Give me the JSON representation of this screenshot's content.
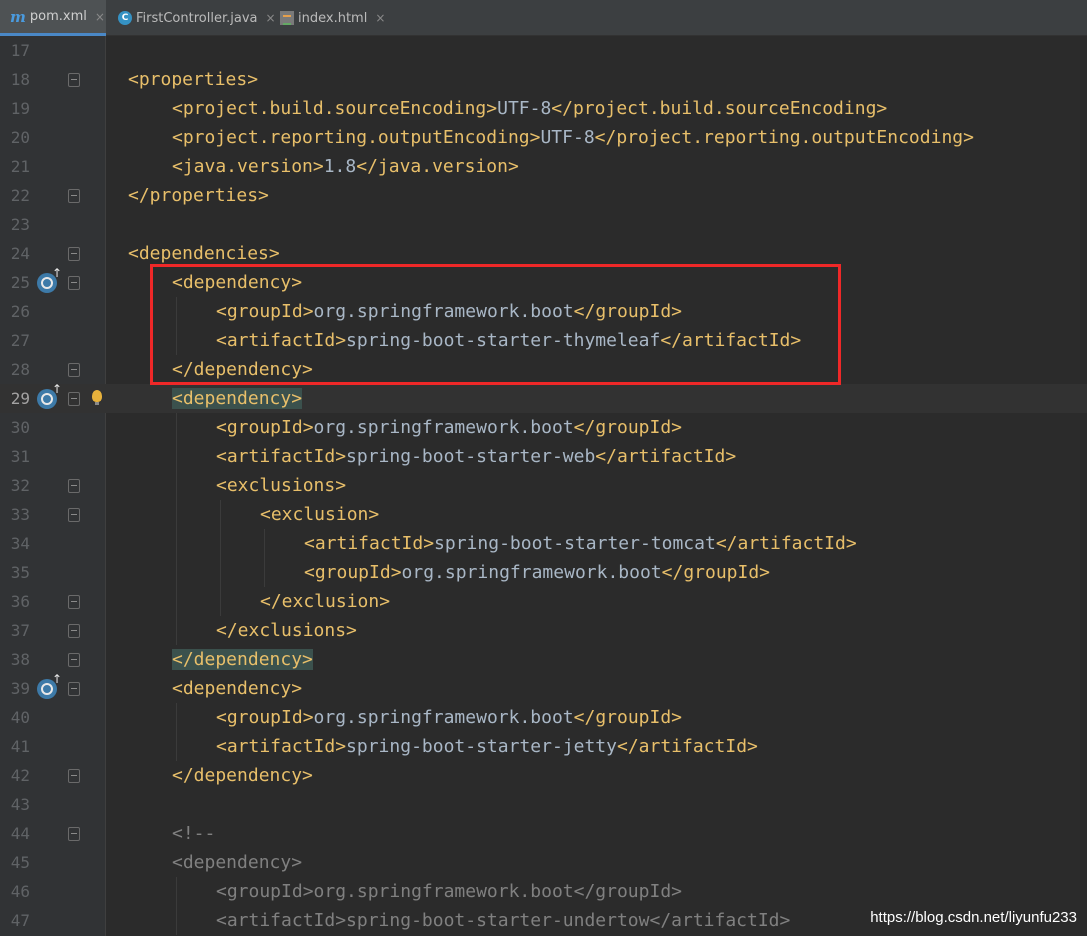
{
  "tabs": [
    {
      "label": "pom.xml",
      "icon": "maven-icon",
      "active": true
    },
    {
      "label": "FirstController.java",
      "icon": "java-class-icon",
      "active": false
    },
    {
      "label": "index.html",
      "icon": "html-file-icon",
      "active": false
    }
  ],
  "tab_close_glyph": "×",
  "lines": [
    {
      "n": "17",
      "indent": 0,
      "code": []
    },
    {
      "n": "18",
      "indent": 0,
      "code": [
        [
          "tag",
          "<properties>"
        ]
      ]
    },
    {
      "n": "19",
      "indent": 1,
      "code": [
        [
          "tag",
          "<project.build.sourceEncoding>"
        ],
        [
          "txt",
          "UTF-8"
        ],
        [
          "tag",
          "</project.build.sourceEncoding>"
        ]
      ]
    },
    {
      "n": "20",
      "indent": 1,
      "code": [
        [
          "tag",
          "<project.reporting.outputEncoding>"
        ],
        [
          "txt",
          "UTF-8"
        ],
        [
          "tag",
          "</project.reporting.outputEncoding>"
        ]
      ]
    },
    {
      "n": "21",
      "indent": 1,
      "code": [
        [
          "tag",
          "<java.version>"
        ],
        [
          "txt",
          "1.8"
        ],
        [
          "tag",
          "</java.version>"
        ]
      ]
    },
    {
      "n": "22",
      "indent": 0,
      "code": [
        [
          "tag",
          "</properties>"
        ]
      ]
    },
    {
      "n": "23",
      "indent": 0,
      "code": []
    },
    {
      "n": "24",
      "indent": 0,
      "code": [
        [
          "tag",
          "<dependencies>"
        ]
      ]
    },
    {
      "n": "25",
      "indent": 1,
      "code": [
        [
          "tag",
          "<dependency>"
        ]
      ]
    },
    {
      "n": "26",
      "indent": 2,
      "code": [
        [
          "tag",
          "<groupId>"
        ],
        [
          "txt",
          "org.springframework.boot"
        ],
        [
          "tag",
          "</groupId>"
        ]
      ]
    },
    {
      "n": "27",
      "indent": 2,
      "code": [
        [
          "tag",
          "<artifactId>"
        ],
        [
          "txt",
          "spring-boot-starter-thymeleaf"
        ],
        [
          "tag",
          "</artifactId>"
        ]
      ]
    },
    {
      "n": "28",
      "indent": 1,
      "code": [
        [
          "tag",
          "</dependency>"
        ]
      ]
    },
    {
      "n": "29",
      "indent": 1,
      "code": [
        [
          "hl",
          "<dependency>"
        ]
      ]
    },
    {
      "n": "30",
      "indent": 2,
      "code": [
        [
          "tag",
          "<groupId>"
        ],
        [
          "txt",
          "org.springframework.boot"
        ],
        [
          "tag",
          "</groupId>"
        ]
      ]
    },
    {
      "n": "31",
      "indent": 2,
      "code": [
        [
          "tag",
          "<artifactId>"
        ],
        [
          "txt",
          "spring-boot-starter-web"
        ],
        [
          "tag",
          "</artifactId>"
        ]
      ]
    },
    {
      "n": "32",
      "indent": 2,
      "code": [
        [
          "tag",
          "<exclusions>"
        ]
      ]
    },
    {
      "n": "33",
      "indent": 3,
      "code": [
        [
          "tag",
          "<exclusion>"
        ]
      ]
    },
    {
      "n": "34",
      "indent": 4,
      "code": [
        [
          "tag",
          "<artifactId>"
        ],
        [
          "txt",
          "spring-boot-starter-tomcat"
        ],
        [
          "tag",
          "</artifactId>"
        ]
      ]
    },
    {
      "n": "35",
      "indent": 4,
      "code": [
        [
          "tag",
          "<groupId>"
        ],
        [
          "txt",
          "org.springframework.boot"
        ],
        [
          "tag",
          "</groupId>"
        ]
      ]
    },
    {
      "n": "36",
      "indent": 3,
      "code": [
        [
          "tag",
          "</exclusion>"
        ]
      ]
    },
    {
      "n": "37",
      "indent": 2,
      "code": [
        [
          "tag",
          "</exclusions>"
        ]
      ]
    },
    {
      "n": "38",
      "indent": 1,
      "code": [
        [
          "hl",
          "</dependency>"
        ]
      ]
    },
    {
      "n": "39",
      "indent": 1,
      "code": [
        [
          "tag",
          "<dependency>"
        ]
      ]
    },
    {
      "n": "40",
      "indent": 2,
      "code": [
        [
          "tag",
          "<groupId>"
        ],
        [
          "txt",
          "org.springframework.boot"
        ],
        [
          "tag",
          "</groupId>"
        ]
      ]
    },
    {
      "n": "41",
      "indent": 2,
      "code": [
        [
          "tag",
          "<artifactId>"
        ],
        [
          "txt",
          "spring-boot-starter-jetty"
        ],
        [
          "tag",
          "</artifactId>"
        ]
      ]
    },
    {
      "n": "42",
      "indent": 1,
      "code": [
        [
          "tag",
          "</dependency>"
        ]
      ]
    },
    {
      "n": "43",
      "indent": 0,
      "code": []
    },
    {
      "n": "44",
      "indent": 1,
      "code": [
        [
          "cmt",
          "<!--"
        ]
      ]
    },
    {
      "n": "45",
      "indent": 1,
      "code": [
        [
          "cmt",
          "<dependency>"
        ]
      ]
    },
    {
      "n": "46",
      "indent": 2,
      "code": [
        [
          "cmt",
          "<groupId>org.springframework.boot</groupId>"
        ]
      ]
    },
    {
      "n": "47",
      "indent": 2,
      "code": [
        [
          "cmt",
          "<artifactId>spring-boot-starter-undertow</artifactId>"
        ]
      ]
    }
  ],
  "current_line": "29",
  "gutter_marks": {
    "override_lines": [
      "25",
      "29",
      "39"
    ],
    "bulb_lines": [
      "29"
    ],
    "fold_lines": [
      "18",
      "22",
      "24",
      "25",
      "28",
      "29",
      "32",
      "33",
      "36",
      "37",
      "38",
      "39",
      "42",
      "44"
    ]
  },
  "watermark": "https://blog.csdn.net/liyunfu233",
  "colors": {
    "background": "#2b2b2b",
    "tag": "#e8bf6a",
    "text": "#a9b7c6",
    "comment": "#808080",
    "annotation_box": "#ef2828"
  }
}
